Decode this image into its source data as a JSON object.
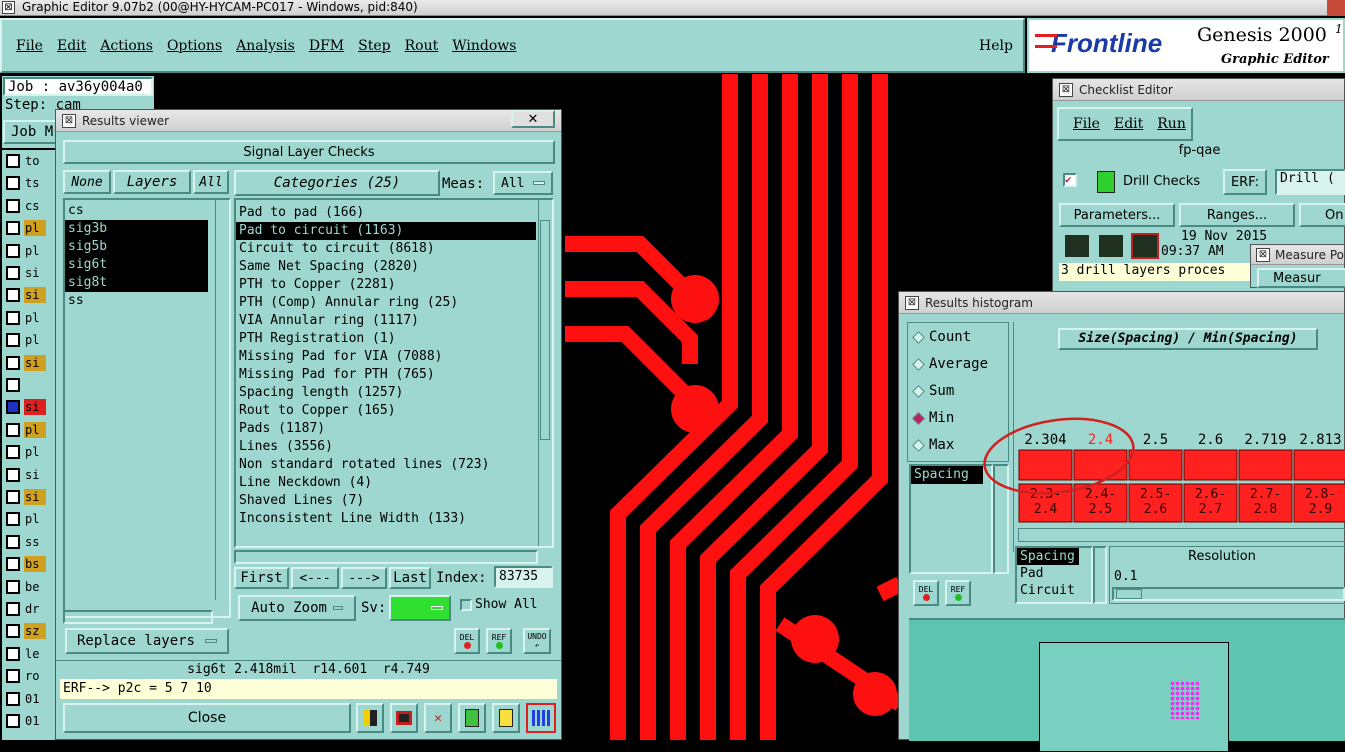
{
  "os_title": "Graphic Editor 9.07b2 (00@HY-HYCAM-PC017 - Windows, pid:840)",
  "menu": [
    "File",
    "Edit",
    "Actions",
    "Options",
    "Analysis",
    "DFM",
    "Step",
    "Rout",
    "Windows"
  ],
  "help": "Help",
  "brand": {
    "logo": "Frontline",
    "product": "Genesis 2000",
    "subtitle": "Graphic Editor",
    "superscript": "1"
  },
  "job": {
    "job": "Job : av36y004a0",
    "step": "Step: cam",
    "job_btn": "Job M"
  },
  "left_layers": [
    "to",
    "ts",
    "cs",
    "pl",
    "pl",
    "si",
    "si",
    "pl",
    "pl",
    "si",
    "",
    "si",
    "pl",
    "pl",
    "si",
    "si",
    "pl",
    "ss",
    "bs",
    "be",
    "dr",
    "sz",
    "le",
    "ro",
    "01",
    "01"
  ],
  "results_viewer": {
    "title": "Results viewer",
    "header": "Signal Layer Checks",
    "none": "None",
    "layers": "Layers",
    "all": "All",
    "categories": "Categories (25)",
    "meas_label": "Meas:",
    "meas_value": "All",
    "layer_list": [
      {
        "name": "cs",
        "sel": false
      },
      {
        "name": "sig3b",
        "sel": true
      },
      {
        "name": "sig5b",
        "sel": true
      },
      {
        "name": "sig6t",
        "sel": true
      },
      {
        "name": "sig8t",
        "sel": true
      },
      {
        "name": "ss",
        "sel": false
      }
    ],
    "categories_list": [
      "Pad to pad (166)",
      "Pad to circuit (1163)",
      "Circuit to circuit (8618)",
      "Same Net Spacing (2820)",
      "PTH to Copper (2281)",
      "PTH (Comp) Annular ring (25)",
      "VIA Annular ring (1117)",
      "PTH Registration (1)",
      "Missing Pad for VIA (7088)",
      "Missing Pad for PTH (765)",
      "Spacing length (1257)",
      "Rout to Copper (165)",
      "Pads (1187)",
      "Lines (3556)",
      "Non standard rotated lines (723)",
      "Line Neckdown (4)",
      "Shaved Lines (7)",
      "Inconsistent Line Width (133)"
    ],
    "selected_category": 1,
    "nav": {
      "first": "First",
      "prev": "<---",
      "next": "--->",
      "last": "Last",
      "index_label": "Index:",
      "index_value": "83735"
    },
    "auto_zoom": "Auto Zoom",
    "sv": "Sv:",
    "show_all": "Show All",
    "replace_layers": "Replace layers",
    "del": "DEL",
    "ref": "REF",
    "undo": "UNDO",
    "status": "sig6t 2.418mil  r14.601  r4.749",
    "erf": "ERF--> p2c = 5 7 10",
    "close": "Close"
  },
  "checklist": {
    "title": "Checklist Editor",
    "menu": [
      "File",
      "Edit",
      "Run"
    ],
    "name": "fp-qae",
    "check": "Drill Checks",
    "erf_label": "ERF:",
    "erf_value": "Drill (",
    "parameters": "Parameters...",
    "ranges": "Ranges...",
    "on": "On",
    "date": "19 Nov 2015",
    "time": "09:37 AM",
    "message": "3 drill layers proces"
  },
  "measure": {
    "title": "Measure Po",
    "btn": "Measur"
  },
  "histogram": {
    "title": "Results histogram",
    "options": [
      "Count",
      "Average",
      "Sum",
      "Min",
      "Max"
    ],
    "selected": "Min",
    "heading": "Size(Spacing) / Min(Spacing)",
    "bins": [
      {
        "value": "2.304",
        "range": "2.3-2.4"
      },
      {
        "value": "2.4",
        "range": "2.4-2.5"
      },
      {
        "value": "2.5",
        "range": "2.5-2.6"
      },
      {
        "value": "2.6",
        "range": "2.6-2.7"
      },
      {
        "value": "2.719",
        "range": "2.7-2.8"
      },
      {
        "value": "2.813",
        "range": "2.8-2.9"
      }
    ],
    "highlight_index": 1,
    "list_top": [
      "Spacing"
    ],
    "list_bottom": [
      "Spacing",
      "Pad",
      "Circuit"
    ],
    "resolution_label": "Resolution",
    "resolution_value": "0.1",
    "del": "DEL",
    "ref": "REF"
  },
  "colors": {
    "accent": "#9ed7cf",
    "trace": "#ff1010",
    "highlight": "#ff2020",
    "canvas": "#000000",
    "preview": "#5cc4b0"
  }
}
